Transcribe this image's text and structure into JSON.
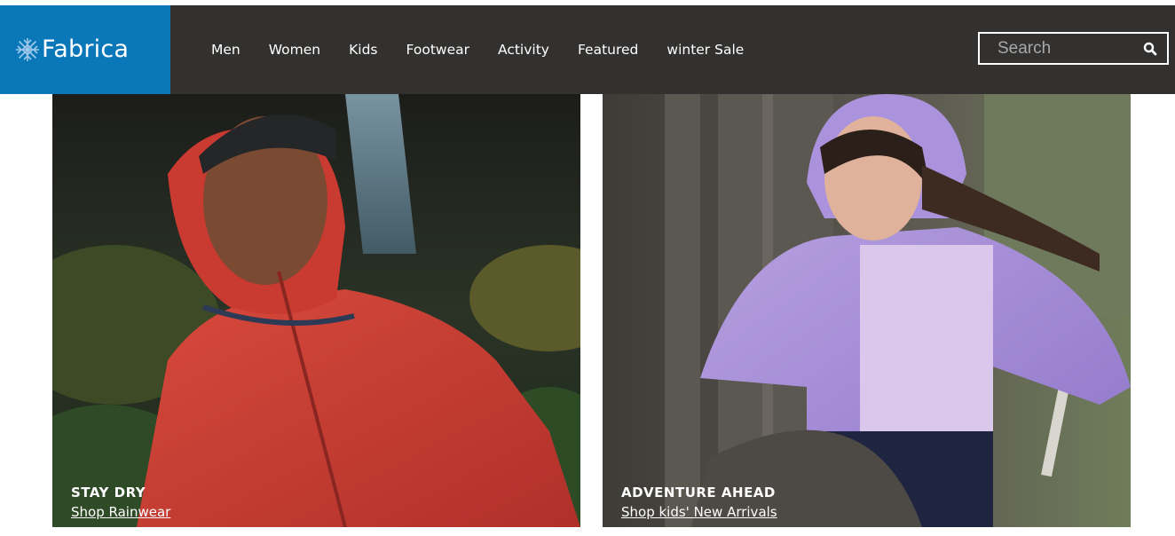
{
  "brand": {
    "name": "Fabrica",
    "logo_icon": "snowflake-icon",
    "color": "#0a78b8"
  },
  "nav": {
    "background": "#323130",
    "items": [
      {
        "label": "Men"
      },
      {
        "label": "Women"
      },
      {
        "label": "Kids"
      },
      {
        "label": "Footwear"
      },
      {
        "label": "Activity"
      },
      {
        "label": "Featured"
      },
      {
        "label": "winter Sale"
      }
    ]
  },
  "search": {
    "placeholder": "Search",
    "value": "",
    "icon": "search-icon"
  },
  "promos": [
    {
      "title": "STAY DRY",
      "link": "Shop Rainwear"
    },
    {
      "title": "ADVENTURE AHEAD",
      "link": "Shop kids' New Arrivals"
    }
  ]
}
